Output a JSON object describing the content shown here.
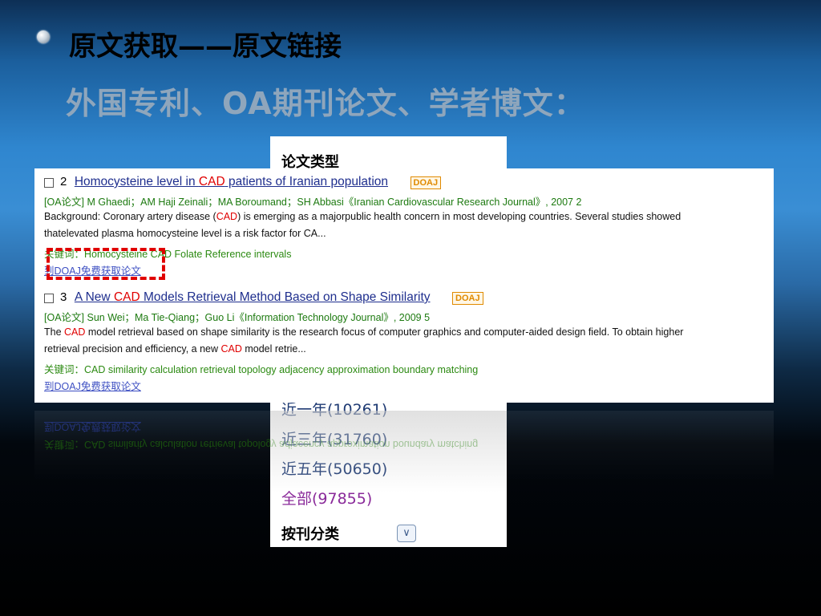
{
  "slide": {
    "title_line1": "原文获取——原文链接",
    "title_line2": "外国专利、OA期刊论文、学者博文："
  },
  "sidebar": {
    "header": "论文类型",
    "items": [
      {
        "label": "近一年(10261)"
      },
      {
        "label": "近三年(31760)"
      },
      {
        "label": "近五年(50650)"
      },
      {
        "label": "全部(97855)"
      }
    ],
    "bottom_label": "按刊分类"
  },
  "results": [
    {
      "number": "2",
      "title_pre": "Homocysteine level in ",
      "title_hl": "CAD",
      "title_post": " patients of Iranian population",
      "badge": "DOAJ",
      "meta": "[OA论文] M Ghaedi；AM Haji Zeinali；MA Boroumand；SH Abbasi《Iranian Cardiovascular Research Journal》, 2007 2",
      "abstract1_pre": "Background: Coronary artery disease (",
      "abstract1_hl": "CAD",
      "abstract1_post": ") is emerging as a majorpublic health concern in most developing countries. Several studies showed",
      "abstract2": "thatelevated plasma homocysteine level is a risk factor for CA...",
      "keywords": "关键词：Homocysteine CAD Folate Reference intervals",
      "link": "到DOAJ免费获取论文"
    },
    {
      "number": "3",
      "title_pre": "A New ",
      "title_hl": "CAD",
      "title_post": " Models Retrieval Method Based on Shape Similarity",
      "badge": "DOAJ",
      "meta": "[OA论文] Sun Wei；Ma Tie-Qiang；Guo Li《Information Technology Journal》, 2009 5",
      "abstract1_pre": "The ",
      "abstract1_hl": "CAD",
      "abstract1_post": " model retrieval based on shape similarity is the research focus of computer graphics and computer-aided design field. To obtain higher",
      "abstract2_pre": "retrieval precision and efficiency, a new ",
      "abstract2_hl": "CAD",
      "abstract2_post": " model retrie...",
      "keywords": "关键词：CAD similarity calculation retrieval topology adjacency approximation boundary matching",
      "link": "到DOAJ免费获取论文"
    }
  ],
  "colors": {
    "highlight": "#e00000",
    "link": "#3d4fc2",
    "title_link": "#1f2f8e",
    "meta": "#1d7a10"
  }
}
